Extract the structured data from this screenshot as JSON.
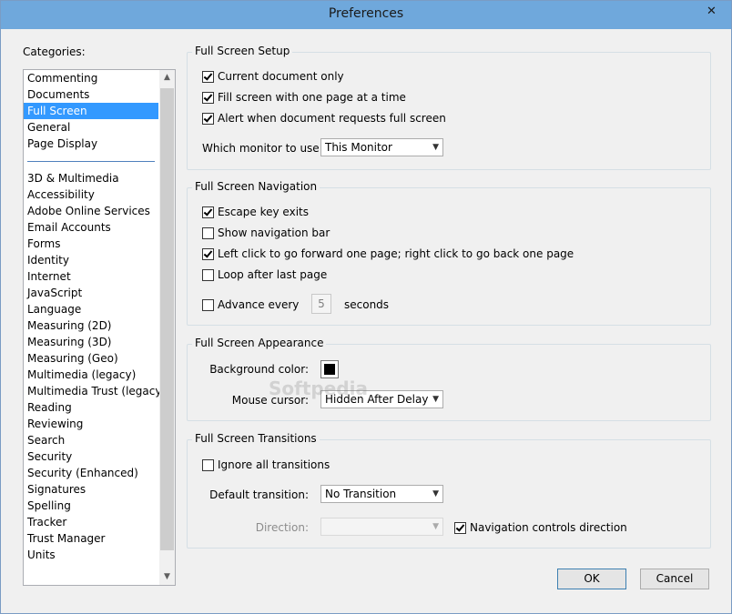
{
  "window": {
    "title": "Preferences",
    "close_glyph": "✕"
  },
  "categories": {
    "label": "Categories:",
    "group1": [
      "Commenting",
      "Documents",
      "Full Screen",
      "General",
      "Page Display"
    ],
    "group2": [
      "3D & Multimedia",
      "Accessibility",
      "Adobe Online Services",
      "Email Accounts",
      "Forms",
      "Identity",
      "Internet",
      "JavaScript",
      "Language",
      "Measuring (2D)",
      "Measuring (3D)",
      "Measuring (Geo)",
      "Multimedia (legacy)",
      "Multimedia Trust (legacy)",
      "Reading",
      "Reviewing",
      "Search",
      "Security",
      "Security (Enhanced)",
      "Signatures",
      "Spelling",
      "Tracker",
      "Trust Manager",
      "Units"
    ],
    "selected": "Full Screen"
  },
  "setup": {
    "title": "Full Screen Setup",
    "current_doc": "Current document only",
    "fill_screen": "Fill screen with one page at a time",
    "alert": "Alert when document requests full screen",
    "monitor_label": "Which monitor to use:",
    "monitor_value": "This Monitor"
  },
  "navigation": {
    "title": "Full Screen Navigation",
    "escape": "Escape key exits",
    "show_nav": "Show navigation bar",
    "left_click": "Left click to go forward one page; right click to go back one page",
    "loop": "Loop after last page",
    "advance": "Advance every",
    "advance_value": "5",
    "seconds": "seconds"
  },
  "appearance": {
    "title": "Full Screen Appearance",
    "bg_label": "Background color:",
    "bg_color": "#000000",
    "cursor_label": "Mouse cursor:",
    "cursor_value": "Hidden After Delay"
  },
  "transitions": {
    "title": "Full Screen Transitions",
    "ignore": "Ignore all transitions",
    "default_label": "Default transition:",
    "default_value": "No Transition",
    "direction_label": "Direction:",
    "nav_controls": "Navigation controls direction"
  },
  "buttons": {
    "ok": "OK",
    "cancel": "Cancel"
  },
  "watermark": "Softpedia",
  "colors": {
    "titlebar": "#6fa8dc",
    "selection": "#3399ff"
  }
}
